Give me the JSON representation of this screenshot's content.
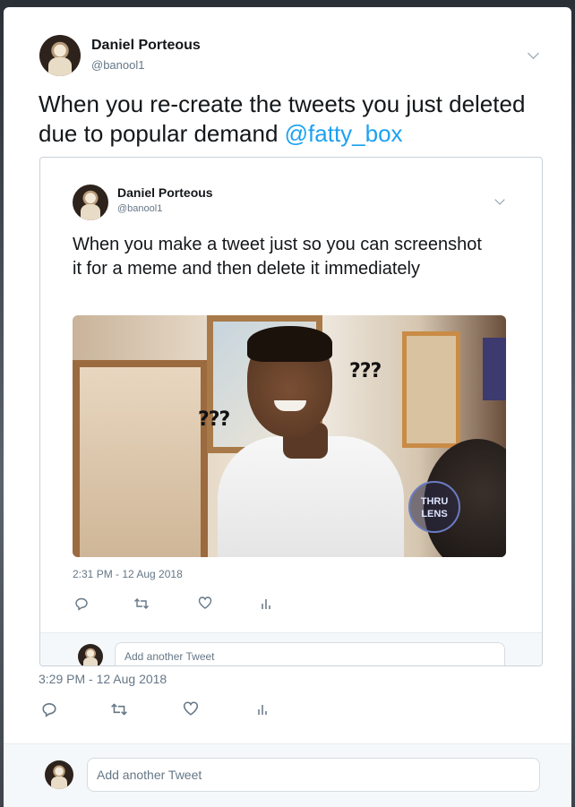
{
  "outer_tweet": {
    "author_name": "Daniel Porteous",
    "author_handle": "@banool1",
    "text": "When you re-create the tweets you just deleted due to popular demand ",
    "mention": "@fatty_box",
    "timestamp": "3:29 PM - 12 Aug 2018",
    "reply_placeholder": "Add another Tweet"
  },
  "embedded_tweet": {
    "author_name": "Daniel Porteous",
    "author_handle": "@banool1",
    "text": "When you make a tweet just so you can screenshot it for a meme and then delete it immediately",
    "image": {
      "caption_left": "???",
      "caption_right": "???",
      "watermark": "THRU LENS"
    },
    "timestamp": "2:31 PM - 12 Aug 2018",
    "reply_placeholder": "Add another Tweet"
  },
  "icons": [
    "reply-icon",
    "retweet-icon",
    "like-icon",
    "analytics-icon",
    "chevron-down-icon"
  ],
  "colors": {
    "link": "#1da1f2",
    "text": "#14171a",
    "muted": "#657786"
  }
}
